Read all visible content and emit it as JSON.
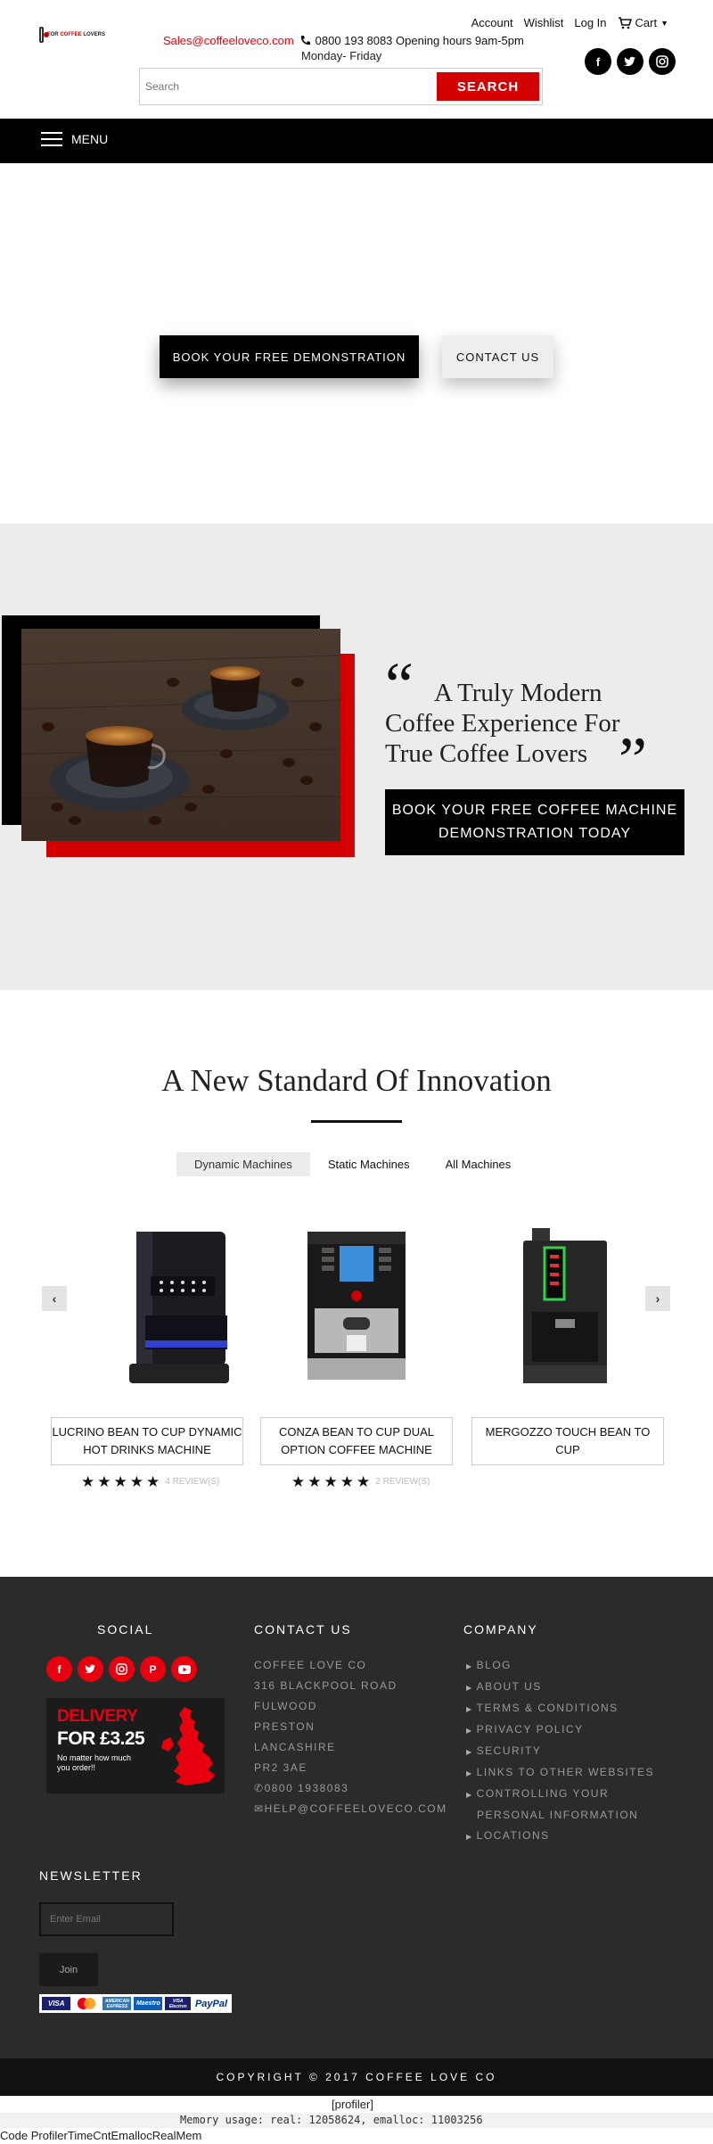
{
  "header": {
    "logo_text_a": "FOR ",
    "logo_text_b": "COFFEE",
    "logo_text_c": " LOVERS",
    "links": [
      "Account",
      "Wishlist",
      "Log In"
    ],
    "cart_label": "Cart",
    "email": "Sales@coffeeloveco.com",
    "phone_hours": "0800 193 8083 Opening hours 9am-5pm",
    "hours_days": "Monday- Friday",
    "social_icons": [
      "facebook-icon",
      "twitter-icon",
      "instagram-icon"
    ],
    "search_placeholder": "Search",
    "search_button": "SEARCH",
    "menu_label": "MENU"
  },
  "hero": {
    "demo_button": "BOOK YOUR FREE DEMONSTRATION",
    "contact_button": "CONTACT US"
  },
  "feature": {
    "quote_open": "“",
    "quote_line1": "A Truly Modern",
    "quote_line2": "Coffee Experience For",
    "quote_line3": "True Coffee Lovers",
    "quote_close": "”",
    "cta_line1": "BOOK YOUR FREE COFFEE MACHINE",
    "cta_line2": "DEMONSTRATION TODAY"
  },
  "innovation": {
    "title": "A New Standard Of Innovation",
    "tabs": [
      "Dynamic Machines",
      "Static Machines",
      "All Machines"
    ],
    "prev_arrow": "‹",
    "next_arrow": "›",
    "products": [
      {
        "name_l1": "LUCRINO BEAN TO CUP DYNAMIC",
        "name_l2": "HOT DRINKS MACHINE",
        "rating": 5,
        "reviews": "4 REVIEW(S)"
      },
      {
        "name_l1": "CONZA BEAN TO CUP DUAL",
        "name_l2": "OPTION COFFEE MACHINE",
        "rating": 5,
        "reviews": "2 REVIEW(S)"
      },
      {
        "name_l1": "MERGOZZO TOUCH BEAN TO CUP",
        "name_l2": "",
        "rating": 0,
        "reviews": ""
      }
    ]
  },
  "footer": {
    "social_title": "SOCIAL",
    "social_icons": [
      "facebook-icon",
      "twitter-icon",
      "instagram-icon",
      "pinterest-icon",
      "youtube-icon"
    ],
    "delivery_title": "DELIVERY",
    "delivery_price": "FOR £3.25",
    "delivery_note": "No matter how much you order!!",
    "contact_title": "CONTACT US",
    "address": [
      "COFFEE LOVE CO",
      "316 BLACKPOOL ROAD",
      "FULWOOD",
      "PRESTON",
      "LANCASHIRE",
      "PR2 3AE"
    ],
    "phone": "0800 1938083",
    "email": "HELP@COFFEELOVECO.COM",
    "company_title": "COMPANY",
    "company_links": [
      "BLOG",
      "ABOUT US",
      "TERMS & CONDITIONS",
      "PRIVACY POLICY",
      "SECURITY",
      "LINKS TO OTHER WEBSITES",
      "CONTROLLING YOUR",
      "PERSONAL INFORMATION",
      "LOCATIONS"
    ],
    "newsletter_title": "NEWSLETTER",
    "newsletter_placeholder": "Enter Email",
    "join_button": "Join",
    "payment_cards": [
      "VISA",
      "mastercard-icon",
      "AMERICAN EXPRESS",
      "Maestro",
      "VISA Electron",
      "PayPal"
    ],
    "copyright": "COPYRIGHT © 2017 COFFEE LOVE CO"
  },
  "profiler": {
    "label": "[profiler]",
    "memory": "Memory usage: real: 12058624, emalloc: 11003256",
    "columns": "Code ProfilerTimeCntEmallocRealMem"
  },
  "colors": {
    "brand_red": "#d30000",
    "email_red": "#e8000e",
    "footer_bg": "#2b2b2b",
    "section_gray": "#ececec"
  }
}
